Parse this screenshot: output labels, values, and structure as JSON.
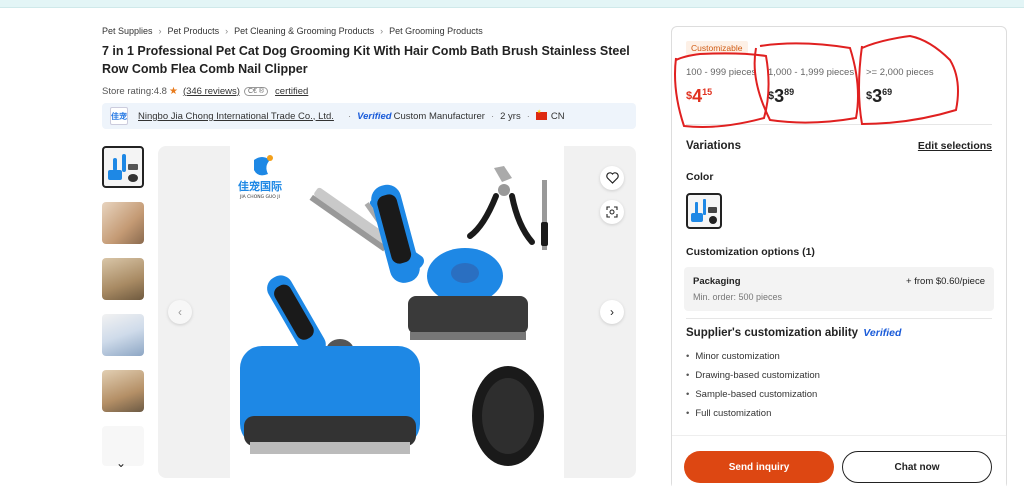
{
  "breadcrumb": [
    "Pet Supplies",
    "Pet Products",
    "Pet Cleaning & Grooming Products",
    "Pet Grooming Products"
  ],
  "product": {
    "title": "7 in 1 Professional Pet Cat Dog Grooming Kit With Hair Comb Bath Brush Stainless Steel Row Comb Flea Comb Nail Clipper"
  },
  "rating": {
    "label": "Store rating:",
    "value": "4.8",
    "reviews": "(346 reviews)",
    "ce_mark": "C€ ®",
    "certified": "certified"
  },
  "supplier": {
    "logo_text": "佳宠",
    "name": "Ningbo Jia Chong International Trade Co., Ltd.",
    "verified": "Verified",
    "type": "Custom Manufacturer",
    "years": "2 yrs",
    "country": "CN"
  },
  "gallery": {
    "brand_cn": "佳宠国际",
    "brand_en": "JIA CHONG GUO JI"
  },
  "pricing": {
    "badge": "Customizable",
    "tiers": [
      {
        "qty": "100 - 999 pieces",
        "currency": "$",
        "whole": "4",
        "cents": "15"
      },
      {
        "qty": "1,000 - 1,999 pieces",
        "currency": "$",
        "whole": "3",
        "cents": "89"
      },
      {
        "qty": ">= 2,000 pieces",
        "currency": "$",
        "whole": "3",
        "cents": "69"
      }
    ]
  },
  "variations": {
    "title": "Variations",
    "edit": "Edit selections",
    "color_label": "Color"
  },
  "customization": {
    "title": "Customization options (1)",
    "packaging_name": "Packaging",
    "packaging_price": "+ from $0.60/piece",
    "packaging_min": "Min. order: 500 pieces"
  },
  "ability": {
    "title": "Supplier's customization ability",
    "verified": "Verified",
    "items": [
      "Minor customization",
      "Drawing-based customization",
      "Sample-based customization",
      "Full customization"
    ]
  },
  "actions": {
    "inquiry": "Send inquiry",
    "chat": "Chat now"
  },
  "colors": {
    "accent": "#dd4712",
    "tool_blue": "#1e88e5",
    "scribble": "#e02020"
  }
}
